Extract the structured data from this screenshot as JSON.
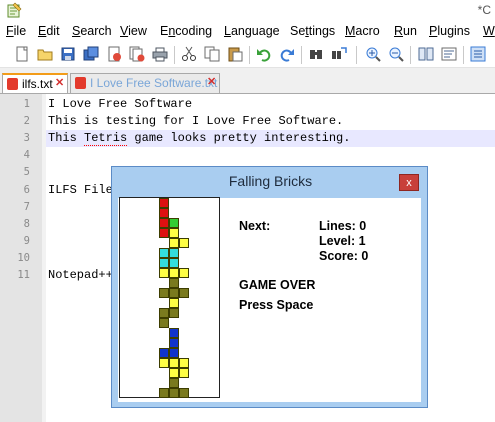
{
  "window": {
    "title": "*C"
  },
  "menu": [
    {
      "id": "file",
      "pre": "",
      "u": "F",
      "post": "ile"
    },
    {
      "id": "edit",
      "pre": "",
      "u": "E",
      "post": "dit"
    },
    {
      "id": "search",
      "pre": "",
      "u": "S",
      "post": "earch"
    },
    {
      "id": "view",
      "pre": "",
      "u": "V",
      "post": "iew"
    },
    {
      "id": "encoding",
      "pre": "E",
      "u": "n",
      "post": "coding"
    },
    {
      "id": "language",
      "pre": "",
      "u": "L",
      "post": "anguage"
    },
    {
      "id": "settings",
      "pre": "Se",
      "u": "t",
      "post": "tings"
    },
    {
      "id": "macro",
      "pre": "",
      "u": "M",
      "post": "acro"
    },
    {
      "id": "run",
      "pre": "",
      "u": "R",
      "post": "un"
    },
    {
      "id": "plugins",
      "pre": "",
      "u": "P",
      "post": "lugins"
    },
    {
      "id": "window",
      "pre": "",
      "u": "W",
      "post": ""
    }
  ],
  "toolbar": [
    "new-file-icon",
    "open-file-icon",
    "save-icon",
    "save-all-icon",
    "close-icon",
    "close-all-icon",
    "print-icon",
    "cut-icon",
    "copy-icon",
    "paste-icon",
    "undo-icon",
    "redo-icon",
    "find-icon",
    "replace-icon",
    "zoom-in-icon",
    "zoom-out-icon",
    "sync-scroll-icon",
    "word-wrap-icon",
    "all-chars-icon"
  ],
  "tabs": [
    {
      "label": "ilfs.txt",
      "active": true,
      "close": "✕"
    },
    {
      "label": "I Love Free Software.txt",
      "active": false,
      "close": "✕"
    }
  ],
  "editor": {
    "lines": [
      {
        "n": "1",
        "text": "I Love Free Software"
      },
      {
        "n": "2",
        "text": "This is testing for I Love Free Software."
      },
      {
        "n": "3",
        "text": "This Tetris game looks pretty interesting."
      },
      {
        "n": "4",
        "text": ""
      },
      {
        "n": "5",
        "text": ""
      },
      {
        "n": "6",
        "text": "ILFS File"
      },
      {
        "n": "7",
        "text": ""
      },
      {
        "n": "8",
        "text": ""
      },
      {
        "n": "9",
        "text": ""
      },
      {
        "n": "10",
        "text": ""
      },
      {
        "n": "11",
        "text": "Notepad++"
      }
    ],
    "misspelled_word": "Tetris"
  },
  "game": {
    "title": "Falling Bricks",
    "close_label": "x",
    "next_label": "Next:",
    "lines": "Lines: 0",
    "level": "Level: 1",
    "score": "Score: 0",
    "status": "GAME OVER",
    "hint": "Press Space",
    "colors": {
      "red": "#dd1111",
      "green": "#33cc33",
      "cyan": "#33dddd",
      "yellow": "#ffff44",
      "olive": "#7a7a1e",
      "blue": "#1133cc"
    },
    "board_cells": [
      {
        "c": 4,
        "r": 0,
        "color": "red"
      },
      {
        "c": 4,
        "r": 1,
        "color": "red"
      },
      {
        "c": 4,
        "r": 2,
        "color": "red"
      },
      {
        "c": 4,
        "r": 3,
        "color": "red"
      },
      {
        "c": 5,
        "r": 2,
        "color": "green"
      },
      {
        "c": 5,
        "r": 3,
        "color": "yellow"
      },
      {
        "c": 5,
        "r": 4,
        "color": "yellow"
      },
      {
        "c": 6,
        "r": 4,
        "color": "yellow"
      },
      {
        "c": 4,
        "r": 5,
        "color": "cyan"
      },
      {
        "c": 5,
        "r": 5,
        "color": "cyan"
      },
      {
        "c": 4,
        "r": 6,
        "color": "cyan"
      },
      {
        "c": 5,
        "r": 6,
        "color": "cyan"
      },
      {
        "c": 4,
        "r": 7,
        "color": "yellow"
      },
      {
        "c": 5,
        "r": 7,
        "color": "yellow"
      },
      {
        "c": 6,
        "r": 7,
        "color": "yellow"
      },
      {
        "c": 5,
        "r": 8,
        "color": "olive"
      },
      {
        "c": 4,
        "r": 9,
        "color": "olive"
      },
      {
        "c": 5,
        "r": 9,
        "color": "olive"
      },
      {
        "c": 6,
        "r": 9,
        "color": "olive"
      },
      {
        "c": 5,
        "r": 10,
        "color": "yellow"
      },
      {
        "c": 4,
        "r": 11,
        "color": "olive"
      },
      {
        "c": 5,
        "r": 11,
        "color": "olive"
      },
      {
        "c": 4,
        "r": 12,
        "color": "olive"
      },
      {
        "c": 5,
        "r": 13,
        "color": "blue"
      },
      {
        "c": 5,
        "r": 14,
        "color": "blue"
      },
      {
        "c": 4,
        "r": 15,
        "color": "blue"
      },
      {
        "c": 5,
        "r": 15,
        "color": "blue"
      },
      {
        "c": 4,
        "r": 16,
        "color": "yellow"
      },
      {
        "c": 5,
        "r": 16,
        "color": "yellow"
      },
      {
        "c": 6,
        "r": 16,
        "color": "yellow"
      },
      {
        "c": 5,
        "r": 17,
        "color": "yellow"
      },
      {
        "c": 6,
        "r": 17,
        "color": "yellow"
      },
      {
        "c": 5,
        "r": 18,
        "color": "olive"
      },
      {
        "c": 4,
        "r": 19,
        "color": "olive"
      },
      {
        "c": 5,
        "r": 19,
        "color": "olive"
      },
      {
        "c": 6,
        "r": 19,
        "color": "olive"
      }
    ]
  }
}
